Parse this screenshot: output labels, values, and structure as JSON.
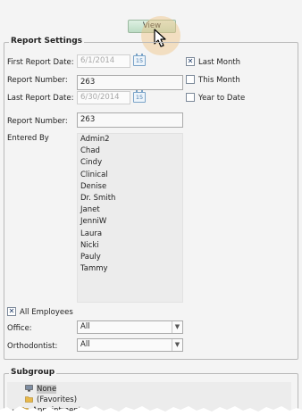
{
  "toolbar": {
    "view_label": "View"
  },
  "report_settings": {
    "title": "Report Settings",
    "first_report_date": {
      "label": "First Report Date:",
      "value": "6/1/2014",
      "calendar_day": "15"
    },
    "report_number_1": {
      "label": "Report Number:",
      "value": "263"
    },
    "last_report_date": {
      "label": "Last Report Date:",
      "value": "6/30/2014",
      "calendar_day": "15"
    },
    "report_number_2": {
      "label": "Report Number:",
      "value": "263"
    },
    "entered_by": {
      "label": "Entered By",
      "users": [
        "Admin2",
        "Chad",
        "Cindy",
        "Clinical",
        "Denise",
        "Dr. Smith",
        "Janet",
        "JenniW",
        "Laura",
        "Nicki",
        "Pauly",
        "Tammy"
      ]
    },
    "range_options": [
      {
        "label": "Last Month",
        "checked": true
      },
      {
        "label": "This Month",
        "checked": false
      },
      {
        "label": "Year to Date",
        "checked": false
      }
    ],
    "all_employees": {
      "label": "All Employees",
      "checked": true
    },
    "office": {
      "label": "Office:",
      "value": "All"
    },
    "orthodontist": {
      "label": "Orthodontist:",
      "value": "All"
    }
  },
  "subgroup": {
    "title": "Subgroup",
    "items": [
      {
        "label": "None",
        "icon": "computer-icon",
        "selected": true
      },
      {
        "label": "(Favorites)",
        "icon": "folder-icon",
        "selected": false
      },
      {
        "label": "Appointment",
        "icon": "folder-icon",
        "selected": false
      }
    ]
  },
  "colors": {
    "view_button": "#c6e4cd",
    "checkbox_mark": "#1c3a68",
    "list_background": "#ececec",
    "cursor_highlight": "#f0c482"
  }
}
